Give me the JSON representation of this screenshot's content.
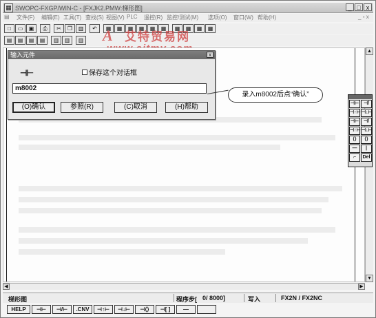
{
  "window": {
    "title": "SWOPC-FXGP/WIN-C - [FXJK2.PMW:梯形图]",
    "controls": [
      "_",
      "□",
      "x"
    ]
  },
  "menu": [
    "文件(F)",
    "编辑(E)",
    "工具(T)",
    "查找(S)",
    "视图(V)",
    "PLC",
    "遥控(R)",
    "监控/测试(M)",
    "选项(O)",
    "窗口(W)",
    "帮助(H)"
  ],
  "watermark": {
    "logo": "A",
    "name": "艾特贸易网",
    "url": "www.aitmy.com"
  },
  "dialog": {
    "title": "输入元件",
    "contact_symbol": "⊣⊢",
    "checkbox_label": "保存这个对话框",
    "entry_value": "m8002",
    "buttons": {
      "ok": "(O)确认",
      "ref": "参照(R)",
      "cancel": "(C)取消",
      "help": "(H)帮助"
    }
  },
  "callout": "录入m8002后点“确认”",
  "palette": [
    "⊣⊢",
    "⊣/⊢",
    "⊣↑⊢",
    "⊣↓⊢",
    "⊣⊢",
    "⊣/⊢",
    "⊣↑⊢",
    "⊣↓⊢",
    "⟨⟩",
    "⟨⟩",
    "—",
    "|",
    "⌐",
    "Del"
  ],
  "status": {
    "view": "梯形图",
    "step_label": "程序步[",
    "step_value": "0/ 8000]",
    "mode": "写入",
    "plc": "FX2N / FX2NC"
  },
  "fkeys": [
    "HELP",
    "⊣⊢",
    "⊣/⊢",
    ".CNV",
    "⊣↑⊢",
    "⊣↓⊢",
    "⊣⟨⟩",
    "⊣[ ]",
    "—"
  ]
}
